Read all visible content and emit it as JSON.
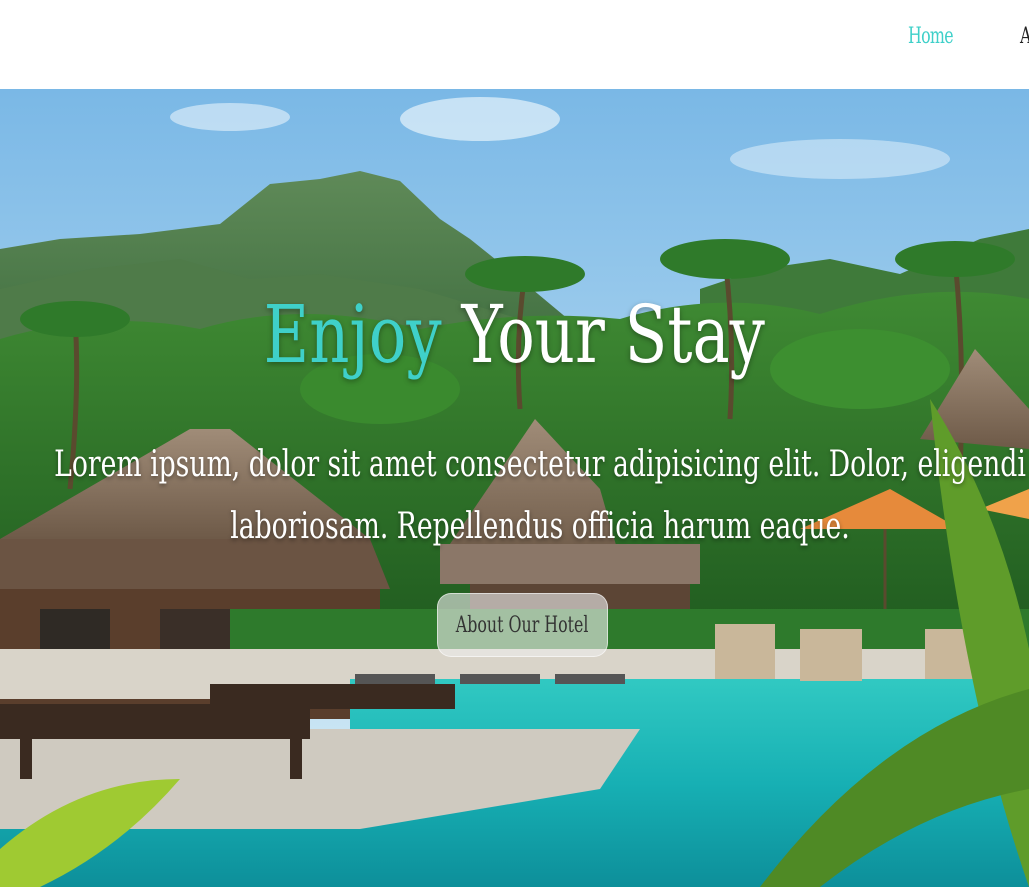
{
  "nav": {
    "items": [
      {
        "label": "Home",
        "active": true
      },
      {
        "label": "About"
      }
    ]
  },
  "hero": {
    "title_accent": "Enjoy",
    "title_rest": "Your Stay",
    "text": "Lorem ipsum, dolor sit amet consectetur adipisicing elit. Dolor, eligendi laboriosam. Repellendus officia harum eaque.",
    "button_label": "About Our Hotel"
  },
  "colors": {
    "accent": "#3fd0c9",
    "nav_text": "#222222",
    "hero_text": "#ffffff"
  }
}
